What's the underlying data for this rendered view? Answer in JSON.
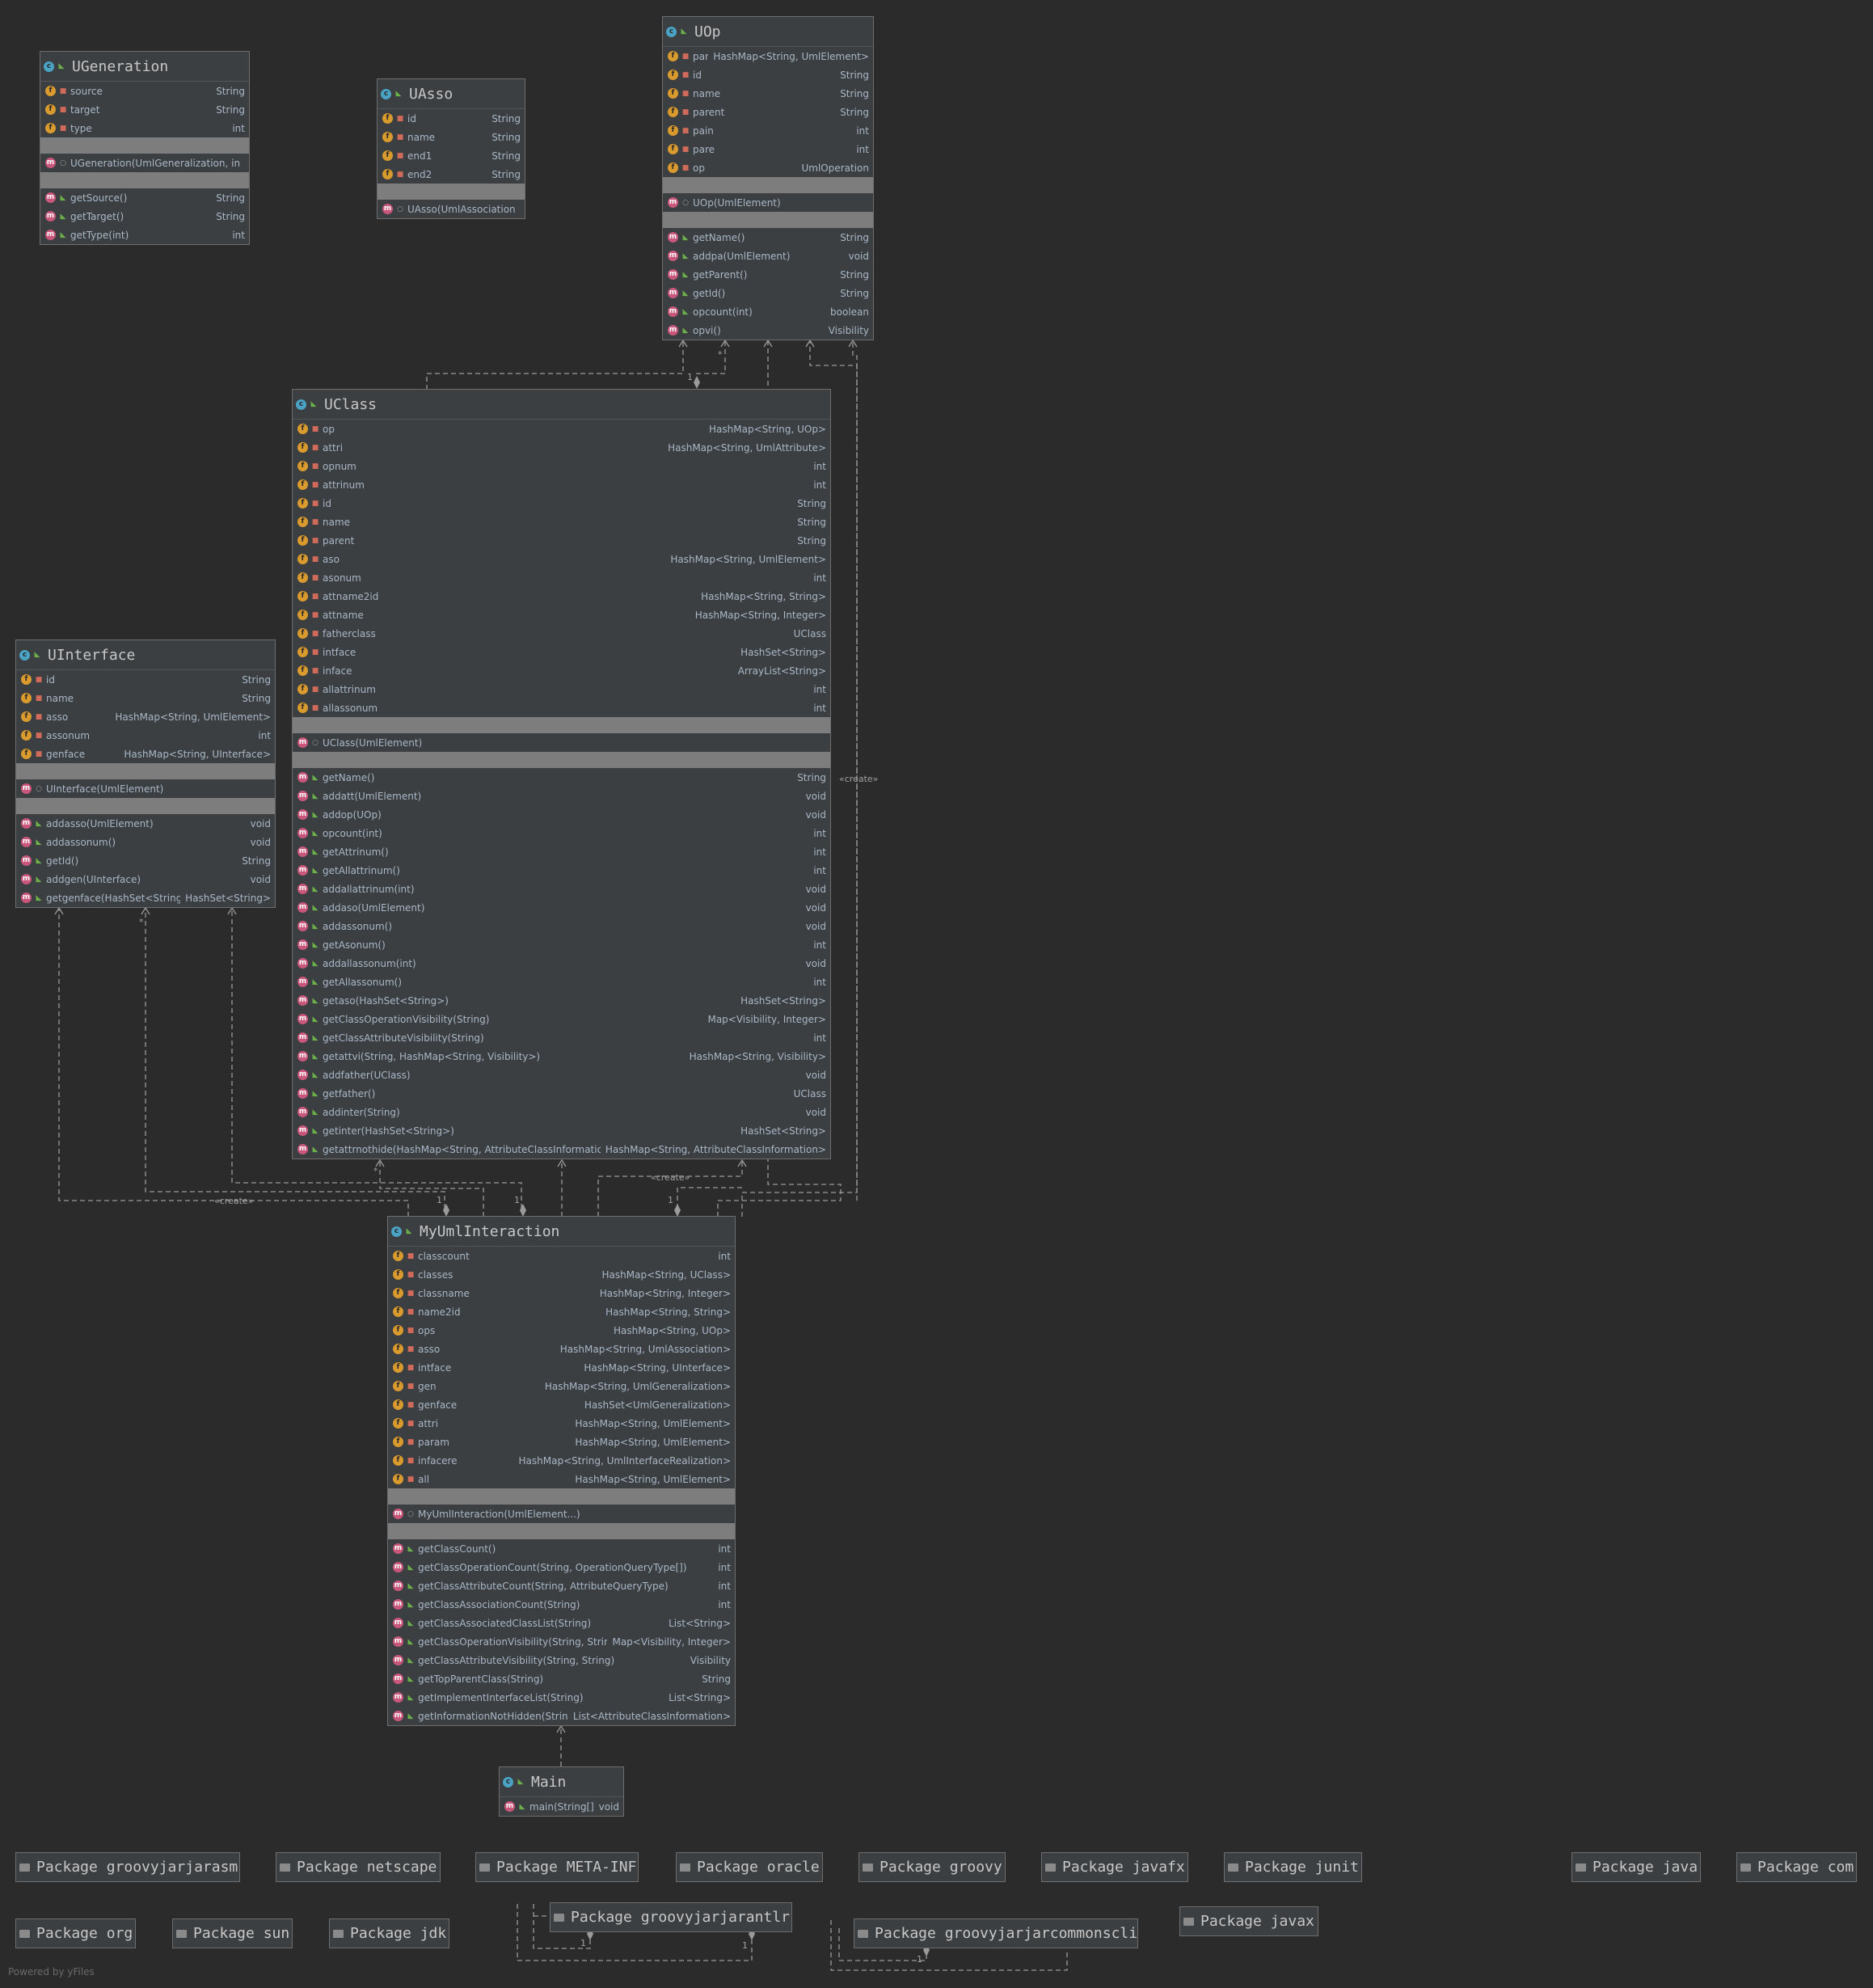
{
  "classes": {
    "ugeneration": {
      "name": "UGeneration",
      "fields": [
        {
          "name": "source",
          "type": "String"
        },
        {
          "name": "target",
          "type": "String"
        },
        {
          "name": "type",
          "type": "int"
        }
      ],
      "constructors": [
        {
          "name": "UGeneration(UmlGeneralization, int)",
          "type": ""
        }
      ],
      "methods": [
        {
          "name": "getSource()",
          "type": "String"
        },
        {
          "name": "getTarget()",
          "type": "String"
        },
        {
          "name": "getType(int)",
          "type": "int"
        }
      ]
    },
    "uasso": {
      "name": "UAsso",
      "fields": [
        {
          "name": "id",
          "type": "String"
        },
        {
          "name": "name",
          "type": "String"
        },
        {
          "name": "end1",
          "type": "String"
        },
        {
          "name": "end2",
          "type": "String"
        }
      ],
      "constructors": [
        {
          "name": "UAsso(UmlAssociation)",
          "type": ""
        }
      ],
      "methods": []
    },
    "uop": {
      "name": "UOp",
      "fields": [
        {
          "name": "para",
          "type": "HashMap<String, UmlElement>"
        },
        {
          "name": "id",
          "type": "String"
        },
        {
          "name": "name",
          "type": "String"
        },
        {
          "name": "parent",
          "type": "String"
        },
        {
          "name": "pain",
          "type": "int"
        },
        {
          "name": "pare",
          "type": "int"
        },
        {
          "name": "op",
          "type": "UmlOperation"
        }
      ],
      "constructors": [
        {
          "name": "UOp(UmlElement)",
          "type": ""
        }
      ],
      "methods": [
        {
          "name": "getName()",
          "type": "String"
        },
        {
          "name": "addpa(UmlElement)",
          "type": "void"
        },
        {
          "name": "getParent()",
          "type": "String"
        },
        {
          "name": "getId()",
          "type": "String"
        },
        {
          "name": "opcount(int)",
          "type": "boolean"
        },
        {
          "name": "opvi()",
          "type": "Visibility"
        }
      ]
    },
    "uclass": {
      "name": "UClass",
      "fields": [
        {
          "name": "op",
          "type": "HashMap<String, UOp>"
        },
        {
          "name": "attri",
          "type": "HashMap<String, UmlAttribute>"
        },
        {
          "name": "opnum",
          "type": "int"
        },
        {
          "name": "attrinum",
          "type": "int"
        },
        {
          "name": "id",
          "type": "String"
        },
        {
          "name": "name",
          "type": "String"
        },
        {
          "name": "parent",
          "type": "String"
        },
        {
          "name": "aso",
          "type": "HashMap<String, UmlElement>"
        },
        {
          "name": "asonum",
          "type": "int"
        },
        {
          "name": "attname2id",
          "type": "HashMap<String, String>"
        },
        {
          "name": "attname",
          "type": "HashMap<String, Integer>"
        },
        {
          "name": "fatherclass",
          "type": "UClass"
        },
        {
          "name": "intface",
          "type": "HashSet<String>"
        },
        {
          "name": "inface",
          "type": "ArrayList<String>"
        },
        {
          "name": "allattrinum",
          "type": "int"
        },
        {
          "name": "allassonum",
          "type": "int"
        }
      ],
      "constructors": [
        {
          "name": "UClass(UmlElement)",
          "type": ""
        }
      ],
      "methods": [
        {
          "name": "getName()",
          "type": "String"
        },
        {
          "name": "addatt(UmlElement)",
          "type": "void"
        },
        {
          "name": "addop(UOp)",
          "type": "void"
        },
        {
          "name": "opcount(int)",
          "type": "int"
        },
        {
          "name": "getAttrinum()",
          "type": "int"
        },
        {
          "name": "getAllattrinum()",
          "type": "int"
        },
        {
          "name": "addallattrinum(int)",
          "type": "void"
        },
        {
          "name": "addaso(UmlElement)",
          "type": "void"
        },
        {
          "name": "addassonum()",
          "type": "void"
        },
        {
          "name": "getAsonum()",
          "type": "int"
        },
        {
          "name": "addallassonum(int)",
          "type": "void"
        },
        {
          "name": "getAllassonum()",
          "type": "int"
        },
        {
          "name": "getaso(HashSet<String>)",
          "type": "HashSet<String>"
        },
        {
          "name": "getClassOperationVisibility(String)",
          "type": "Map<Visibility, Integer>"
        },
        {
          "name": "getClassAttributeVisibility(String)",
          "type": "int"
        },
        {
          "name": "getattvi(String, HashMap<String, Visibility>)",
          "type": "HashMap<String, Visibility>"
        },
        {
          "name": "addfather(UClass)",
          "type": "void"
        },
        {
          "name": "getfather()",
          "type": "UClass"
        },
        {
          "name": "addinter(String)",
          "type": "void"
        },
        {
          "name": "getinter(HashSet<String>)",
          "type": "HashSet<String>"
        },
        {
          "name": "getattrnothide(HashMap<String, AttributeClassInformation>)",
          "type": "HashMap<String, AttributeClassInformation>"
        }
      ]
    },
    "uinterface": {
      "name": "UInterface",
      "fields": [
        {
          "name": "id",
          "type": "String"
        },
        {
          "name": "name",
          "type": "String"
        },
        {
          "name": "asso",
          "type": "HashMap<String, UmlElement>"
        },
        {
          "name": "assonum",
          "type": "int"
        },
        {
          "name": "genface",
          "type": "HashMap<String, UInterface>"
        }
      ],
      "constructors": [
        {
          "name": "UInterface(UmlElement)",
          "type": ""
        }
      ],
      "methods": [
        {
          "name": "addasso(UmlElement)",
          "type": "void"
        },
        {
          "name": "addassonum()",
          "type": "void"
        },
        {
          "name": "getId()",
          "type": "String"
        },
        {
          "name": "addgen(UInterface)",
          "type": "void"
        },
        {
          "name": "getgenface(HashSet<String>)",
          "type": "HashSet<String>"
        }
      ]
    },
    "myumlinteraction": {
      "name": "MyUmlInteraction",
      "fields": [
        {
          "name": "classcount",
          "type": "int"
        },
        {
          "name": "classes",
          "type": "HashMap<String, UClass>"
        },
        {
          "name": "classname",
          "type": "HashMap<String, Integer>"
        },
        {
          "name": "name2id",
          "type": "HashMap<String, String>"
        },
        {
          "name": "ops",
          "type": "HashMap<String, UOp>"
        },
        {
          "name": "asso",
          "type": "HashMap<String, UmlAssociation>"
        },
        {
          "name": "intface",
          "type": "HashMap<String, UInterface>"
        },
        {
          "name": "gen",
          "type": "HashMap<String, UmlGeneralization>"
        },
        {
          "name": "genface",
          "type": "HashSet<UmlGeneralization>"
        },
        {
          "name": "attri",
          "type": "HashMap<String, UmlElement>"
        },
        {
          "name": "param",
          "type": "HashMap<String, UmlElement>"
        },
        {
          "name": "infacere",
          "type": "HashMap<String, UmlInterfaceRealization>"
        },
        {
          "name": "all",
          "type": "HashMap<String, UmlElement>"
        }
      ],
      "constructors": [
        {
          "name": "MyUmlInteraction(UmlElement...)",
          "type": ""
        }
      ],
      "methods": [
        {
          "name": "getClassCount()",
          "type": "int"
        },
        {
          "name": "getClassOperationCount(String, OperationQueryType[])",
          "type": "int"
        },
        {
          "name": "getClassAttributeCount(String, AttributeQueryType)",
          "type": "int"
        },
        {
          "name": "getClassAssociationCount(String)",
          "type": "int"
        },
        {
          "name": "getClassAssociatedClassList(String)",
          "type": "List<String>"
        },
        {
          "name": "getClassOperationVisibility(String, String)",
          "type": "Map<Visibility, Integer>"
        },
        {
          "name": "getClassAttributeVisibility(String, String)",
          "type": "Visibility"
        },
        {
          "name": "getTopParentClass(String)",
          "type": "String"
        },
        {
          "name": "getImplementInterfaceList(String)",
          "type": "List<String>"
        },
        {
          "name": "getInformationNotHidden(String)",
          "type": "List<AttributeClassInformation>"
        }
      ]
    },
    "main": {
      "name": "Main",
      "fields": [],
      "constructors": [],
      "methods": [
        {
          "name": "main(String[])",
          "type": "void"
        }
      ]
    }
  },
  "packages": {
    "groovyjarjarasm": "Package groovyjarjarasm",
    "netscape": "Package netscape",
    "meta_inf": "Package META-INF",
    "oracle": "Package oracle",
    "groovy": "Package groovy",
    "javafx": "Package javafx",
    "junit": "Package junit",
    "java": "Package java",
    "com": "Package com",
    "org": "Package org",
    "sun": "Package sun",
    "jdk": "Package jdk",
    "groovyjarjarantlr": "Package groovyjarjarantlr",
    "groovyjarjarcommonscli": "Package groovyjarjarcommonscli",
    "javax": "Package javax"
  },
  "labels": {
    "create_right": "«create»",
    "create_left": "«create»",
    "create_mid": "«create»",
    "one": "1",
    "star": "*"
  },
  "footer": "Powered by yFiles",
  "colors": {
    "background": "#2b2b2b",
    "node": "#3c3f41",
    "separator": "#7d7d7d",
    "class_icon": "#4aa3c4",
    "field_icon": "#d99a2e",
    "method_icon": "#c8577b"
  }
}
